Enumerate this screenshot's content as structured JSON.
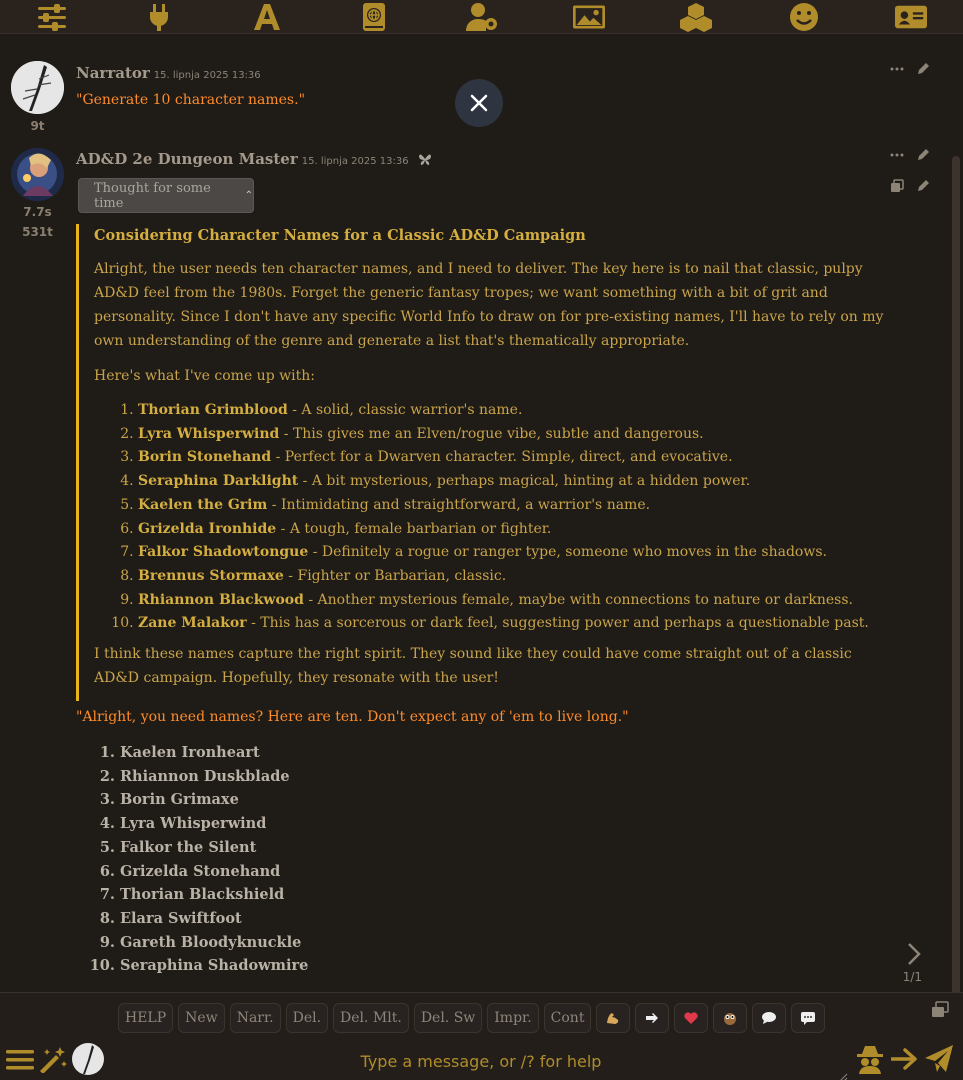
{
  "topbar": {
    "icons": [
      "sliders-icon",
      "plug-icon",
      "font-a-icon",
      "world-book-icon",
      "user-gear-icon",
      "image-icon",
      "cubes-icon",
      "smiley-icon",
      "id-card-icon"
    ]
  },
  "messages": {
    "narrator": {
      "name": "Narrator",
      "timestamp": "15. lipnja 2025 13:36",
      "tokens": "9t",
      "text": "\"Generate 10 character names.\""
    },
    "dm": {
      "name": "AD&D 2e Dungeon Master",
      "timestamp": "15. lipnja 2025 13:36",
      "time_taken": "7.7s",
      "tokens": "531t",
      "thought_label": "Thought for some time",
      "reasoning": {
        "heading": "Considering Character Names for a Classic AD&D Campaign",
        "para1": "Alright, the user needs ten character names, and I need to deliver. The key here is to nail that classic, pulpy AD&D feel from the 1980s. Forget the generic fantasy tropes; we want something with a bit of grit and personality. Since I don't have any specific World Info to draw on for pre-existing names, I'll have to rely on my own understanding of the genre and generate a list that's thematically appropriate.",
        "para2": "Here's what I've come up with:",
        "items": [
          {
            "name": "Thorian Grimblood",
            "desc": " - A solid, classic warrior's name."
          },
          {
            "name": "Lyra Whisperwind",
            "desc": " - This gives me an Elven/rogue vibe, subtle and dangerous."
          },
          {
            "name": "Borin Stonehand",
            "desc": " - Perfect for a Dwarven character. Simple, direct, and evocative."
          },
          {
            "name": "Seraphina Darklight",
            "desc": " - A bit mysterious, perhaps magical, hinting at a hidden power."
          },
          {
            "name": "Kaelen the Grim",
            "desc": " - Intimidating and straightforward, a warrior's name."
          },
          {
            "name": "Grizelda Ironhide",
            "desc": " - A tough, female barbarian or fighter."
          },
          {
            "name": "Falkor Shadowtongue",
            "desc": " - Definitely a rogue or ranger type, someone who moves in the shadows."
          },
          {
            "name": "Brennus Stormaxe",
            "desc": " - Fighter or Barbarian, classic."
          },
          {
            "name": "Rhiannon Blackwood",
            "desc": " - Another mysterious female, maybe with connections to nature or darkness."
          },
          {
            "name": "Zane Malakor",
            "desc": " - This has a sorcerous or dark feel, suggesting power and perhaps a questionable past."
          }
        ],
        "para3": "I think these names capture the right spirit. They sound like they could have come straight out of a classic AD&D campaign. Hopefully, they resonate with the user!"
      },
      "reply_quote": "\"Alright, you need names? Here are ten. Don't expect any of 'em to live long.\"",
      "names": [
        "Kaelen Ironheart",
        "Rhiannon Duskblade",
        "Borin Grimaxe",
        "Lyra Whisperwind",
        "Falkor the Silent",
        "Grizelda Stonehand",
        "Thorian Blackshield",
        "Elara Swiftfoot",
        "Gareth Bloodyknuckle",
        "Seraphina Shadowmire"
      ],
      "swipe_counter": "1/1"
    }
  },
  "quick_replies": [
    "HELP",
    "New",
    "Narr.",
    "Del.",
    "Del. Mlt.",
    "Del. Sw",
    "Impr.",
    "Cont"
  ],
  "input": {
    "placeholder": "Type a message, or /? for help"
  },
  "colors": {
    "accent_gold": "#b08d2a",
    "quote_orange": "#ff8c2a",
    "reasoning_border": "#e8b51a"
  }
}
